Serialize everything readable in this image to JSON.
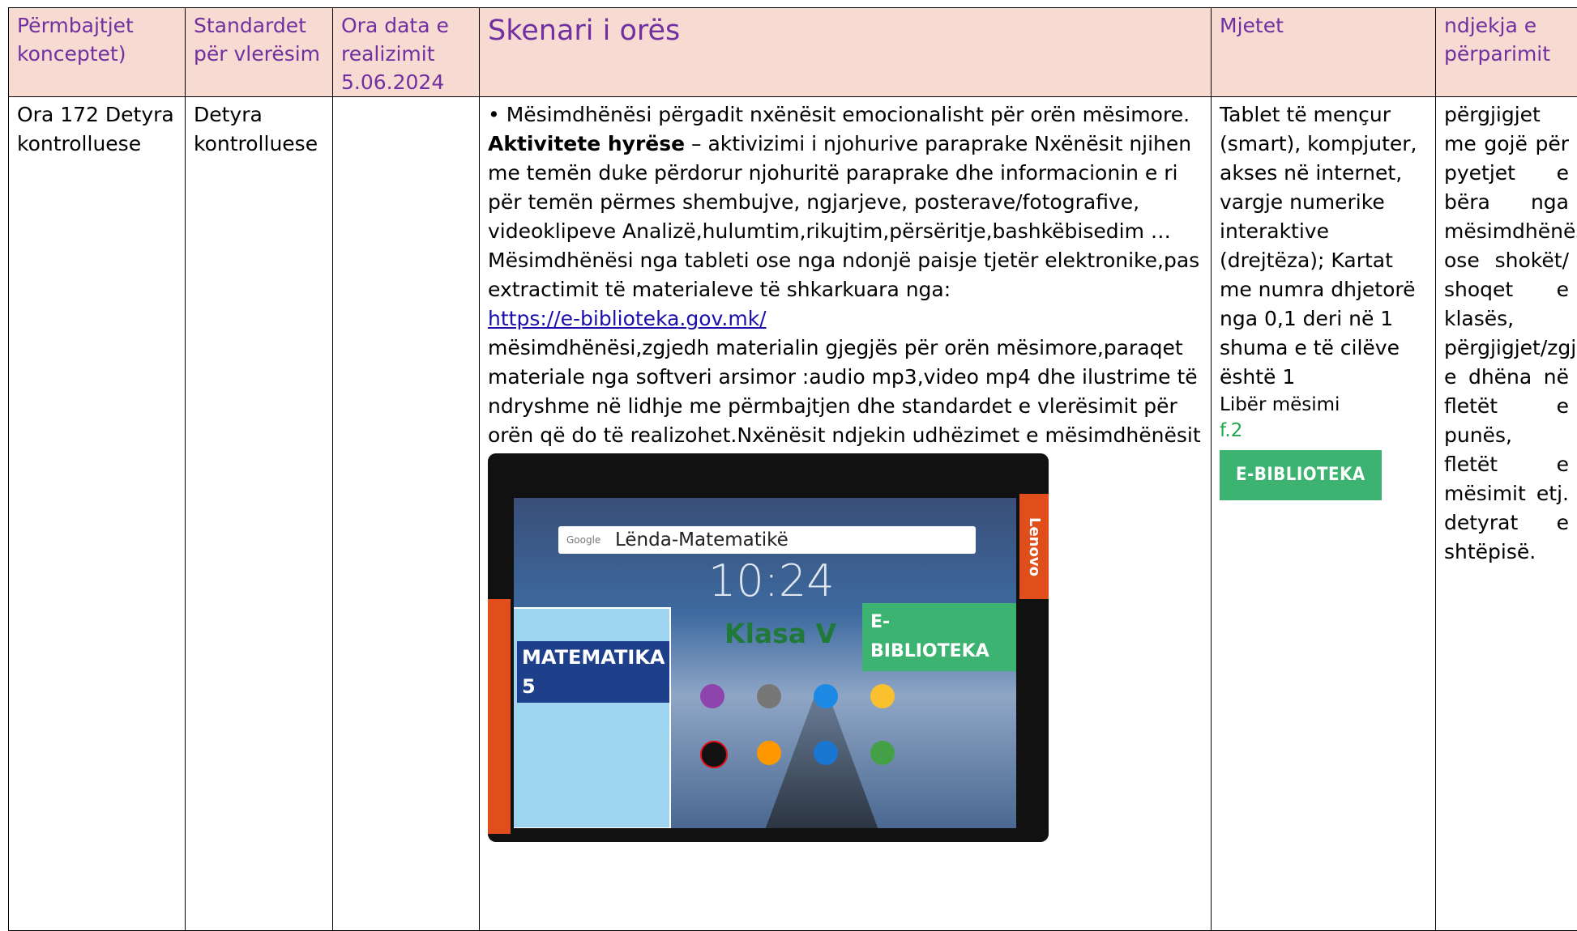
{
  "header": {
    "col1": "Përmbajtjet konceptet)",
    "col2": "Standardet për vlerësim",
    "col3": "Ora data e realizimit 5.06.2024",
    "col4": "Skenari i orës",
    "col5": "Mjetet",
    "col6": "ndjekja e përparimit"
  },
  "row": {
    "col1": "Ora 172 Detyra kontrolluese",
    "col2": "Detyra kontrolluese",
    "col3": "",
    "scenario": {
      "p1": "• Mësimdhënësi përgadit nxënësit emocionalisht për orën mësimore.",
      "bold": "Aktivitete hyrëse",
      "p2": " – aktivizimi i njohurive paraprake Nxënësit njihen me temën duke përdorur njohuritë paraprake dhe informacionin e ri për temën përmes shembujve, ngjarjeve, posterave/fotografive, videoklipeve Analizë,hulumtim,rikujtim,përsëritje,bashkëbisedim … Mësimdhënësi nga tableti ose nga ndonjë paisje tjetër elektronike,pas extractimit të materialeve të shkarkuara nga:",
      "link": "https://e-biblioteka.gov.mk/",
      "p3": "mësimdhënësi,zgjedh materialin gjegjës për orën mësimore,paraqet materiale nga softveri arsimor :audio mp3,video mp4 dhe ilustrime të ndryshme në lidhje me përmbajtjen dhe standardet e vlerësimit për orën që do të realizohet.Nxënësit ndjekin udhëzimet e mësimdhënësit"
    },
    "tools": {
      "text": "Tablet të mençur (smart), kompjuter, akses në internet, vargje numerike interaktive (drejtëza); Kartat me numra dhjetorë nga 0,1 deri në 1 shuma e të cilëve është 1",
      "book": "Libër mësimi",
      "fig": "f.2",
      "badge": "E-BIBLIOTEKA"
    },
    "progress": "përgjigjet me gojë për pyetjet e bëra nga mësimdhënësi ose shokët/ shoqet e klasës, përgjigjet/zgjidhjet e dhëna në fletët e punës, fletët e mësimit etj. detyrat e shtëpisë."
  },
  "tablet": {
    "search": "Lënda-Matematikë",
    "google": "Google",
    "clock": "10:24",
    "book_title": "MATEMATIKA 5",
    "klasa": "Klasa V",
    "badge": "E-BIBLIOTEKA",
    "brand": "Lenovo"
  }
}
